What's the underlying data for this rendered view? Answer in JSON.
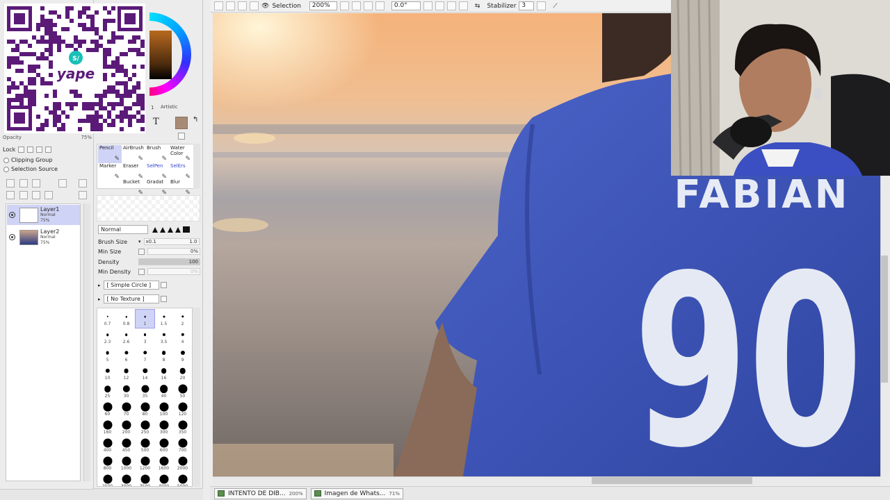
{
  "left_panel": {
    "qr_brand": "yape",
    "qr_symbol": "S/",
    "opacity_label": "Opacity",
    "opacity_value": "75%",
    "lock_label": "Lock",
    "clipping_group": "Clipping Group",
    "selection_source": "Selection Source",
    "layers": [
      {
        "name": "Layer1",
        "mode": "Normal",
        "opacity": "75%"
      },
      {
        "name": "Layer2",
        "mode": "Normal",
        "opacity": "75%"
      }
    ]
  },
  "tool_panel": {
    "tab_mini": "1",
    "tab_artistic": "Artistic",
    "text_tool": "T",
    "main_color": "#a88b76",
    "tools": [
      {
        "label": "Pencil",
        "selected": true,
        "blue": false
      },
      {
        "label": "AirBrush",
        "selected": false,
        "blue": false
      },
      {
        "label": "Brush",
        "selected": false,
        "blue": false
      },
      {
        "label": "Water\nColor",
        "selected": false,
        "blue": false
      },
      {
        "label": "Marker",
        "selected": false,
        "blue": false
      },
      {
        "label": "Eraser",
        "selected": false,
        "blue": false
      },
      {
        "label": "SelPen",
        "selected": false,
        "blue": true
      },
      {
        "label": "SelErs",
        "selected": false,
        "blue": true
      },
      {
        "label": "Bucket",
        "selected": false,
        "blue": false
      },
      {
        "label": "Gradat",
        "selected": false,
        "blue": false
      },
      {
        "label": "Blur",
        "selected": false,
        "blue": false
      }
    ],
    "blend_mode": "Normal",
    "brush_size_label": "Brush Size",
    "brush_size_mult": "x0.1",
    "brush_size_value": "1.0",
    "min_size_label": "Min Size",
    "min_size_value": "0%",
    "density_label": "Density",
    "density_value": "100",
    "min_density_label": "Min Density",
    "min_density_value": "0%",
    "brush_shape": "[ Simple Circle ]",
    "brush_texture": "[ No Texture ]",
    "brush_sizes": [
      "0.7",
      "0.8",
      "1",
      "1.5",
      "2",
      "2.3",
      "2.6",
      "3",
      "3.5",
      "4",
      "5",
      "6",
      "7",
      "8",
      "9",
      "10",
      "12",
      "14",
      "16",
      "20",
      "25",
      "30",
      "35",
      "40",
      "50",
      "60",
      "70",
      "80",
      "100",
      "120",
      "160",
      "200",
      "250",
      "300",
      "350",
      "400",
      "450",
      "500",
      "600",
      "700",
      "800",
      "1000",
      "1200",
      "1600",
      "2000",
      "2500",
      "3000",
      "3500",
      "4000",
      "5000"
    ],
    "selected_brush_size": "1"
  },
  "toolbar": {
    "selection_label": "Selection",
    "zoom": "200%",
    "rotation": "0.0°",
    "stabilizer_label": "Stabilizer",
    "stabilizer_value": "3"
  },
  "canvas": {
    "jersey_name": "FABIAN",
    "jersey_number": "90"
  },
  "status_bar": {
    "docs": [
      {
        "name": "INTENTO DE DIB...",
        "zoom": "200%"
      },
      {
        "name": "Imagen de Whats...",
        "zoom": "71%"
      }
    ]
  }
}
